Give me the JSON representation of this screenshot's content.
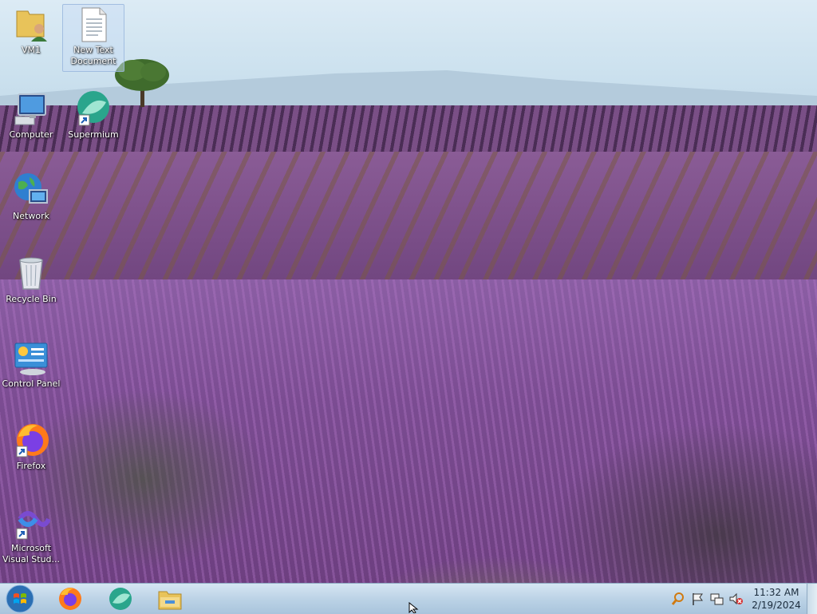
{
  "desktop": {
    "icons": [
      {
        "label": "VM1"
      },
      {
        "label": "New Text\nDocument"
      },
      {
        "label": "Computer"
      },
      {
        "label": "Supermium"
      },
      {
        "label": "Network"
      },
      {
        "label": "Recycle Bin"
      },
      {
        "label": "Control Panel"
      },
      {
        "label": "Firefox"
      },
      {
        "label": "Microsoft\nVisual Stud..."
      }
    ]
  },
  "taskbar": {
    "pinned": [
      "firefox-icon",
      "supermium-icon",
      "file-explorer-icon"
    ],
    "clock": {
      "time": "11:32 AM",
      "date": "2/19/2024"
    },
    "tray_icons": [
      "search-icon",
      "action-center-flag-icon",
      "network-icon",
      "volume-muted-icon"
    ]
  },
  "colors": {
    "taskbar": "#bcd3e6",
    "label_text": "#ffffff"
  }
}
